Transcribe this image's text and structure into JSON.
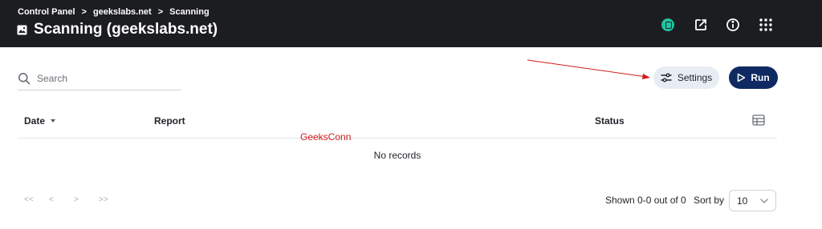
{
  "breadcrumb": [
    "Control Panel",
    "geekslabs.net",
    "Scanning"
  ],
  "breadcrumb_separator": ">",
  "page_title": "Scanning (geekslabs.net)",
  "header_icons": [
    "avatar-icon",
    "external-link-icon",
    "info-icon",
    "apps-grid-icon"
  ],
  "search": {
    "placeholder": "Search",
    "value": ""
  },
  "toolbar": {
    "settings_label": "Settings",
    "run_label": "Run"
  },
  "table": {
    "columns": [
      "Date",
      "Report",
      "Status"
    ],
    "sorted_column": "Date",
    "empty_text": "No records"
  },
  "watermark": "GeeksConn",
  "pagination": {
    "first": "<<",
    "prev": "<",
    "next": ">",
    "last": ">>",
    "shown_text": "Shown 0-0 out of 0",
    "sort_by_label": "Sort by",
    "page_size": "10"
  },
  "colors": {
    "header_bg": "#1c1d21",
    "run_button": "#0f2a63",
    "settings_button": "#e8edf3",
    "annotation": "#d21b1b",
    "avatar": "#1fc4a2"
  }
}
